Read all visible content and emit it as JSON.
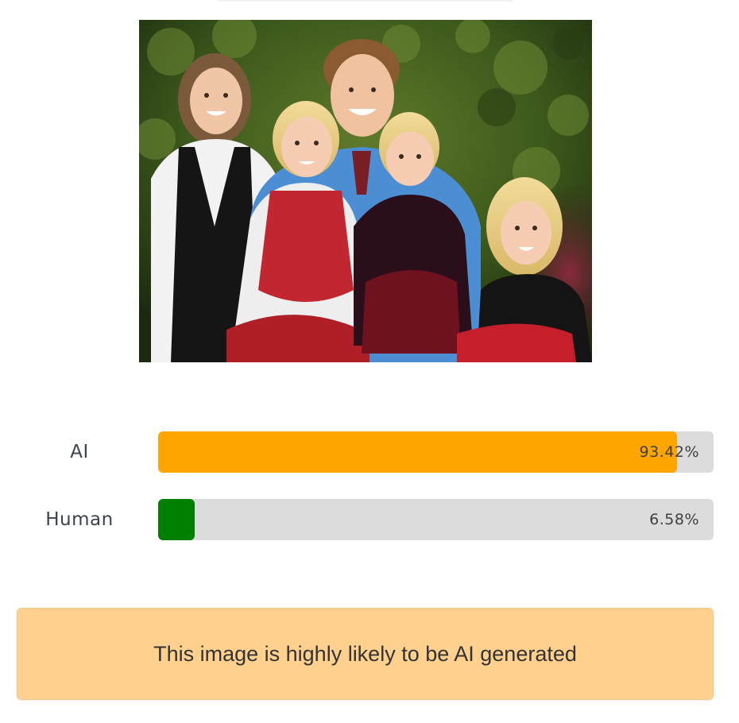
{
  "photo": {
    "subject": "family-portrait-photo"
  },
  "scores": [
    {
      "label": "AI",
      "percent_text": "93.42%",
      "fraction": 0.9342,
      "color": "#ffa500"
    },
    {
      "label": "Human",
      "percent_text": "6.58%",
      "fraction": 0.0658,
      "color": "#008000"
    }
  ],
  "verdict": {
    "text": "This image is highly likely to be AI generated",
    "background": "#ffd08e"
  },
  "colors": {
    "track": "#dcdcdc"
  }
}
